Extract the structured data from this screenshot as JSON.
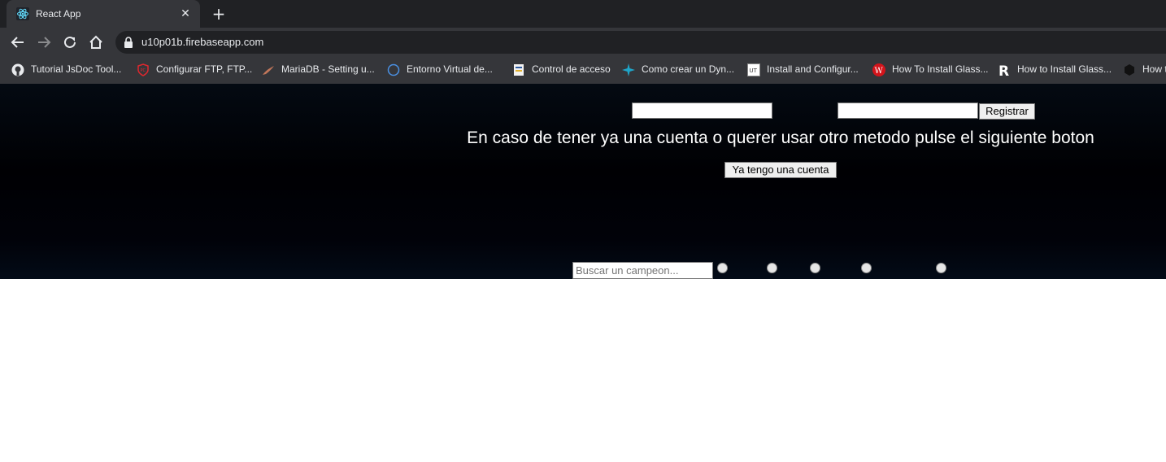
{
  "browser": {
    "tab": {
      "title": "React App",
      "favicon": "react-icon",
      "close_glyph": "✕"
    },
    "new_tab_glyph": "+",
    "toolbar": {
      "back_icon": "back-arrow-icon",
      "forward_icon": "forward-arrow-icon",
      "reload_icon": "reload-icon",
      "home_icon": "home-icon",
      "lock_icon": "lock-icon",
      "url": "u10p01b.firebaseapp.com"
    },
    "bookmarks": [
      {
        "label": "Tutorial JsDoc Tool...",
        "icon": "github-icon"
      },
      {
        "label": "Configurar FTP, FTP...",
        "icon": "shield-icon"
      },
      {
        "label": "MariaDB - Setting u...",
        "icon": "seal-icon"
      },
      {
        "label": "Entorno Virtual de...",
        "icon": "circle-icon"
      },
      {
        "label": "Control de acceso",
        "icon": "document-icon"
      },
      {
        "label": "Como crear un Dyn...",
        "icon": "star-icon"
      },
      {
        "label": "Install and Configur...",
        "icon": "ut-icon"
      },
      {
        "label": "How To Install Glass...",
        "icon": "w-icon"
      },
      {
        "label": "How to Install Glass...",
        "icon": "r-icon"
      },
      {
        "label": "How t",
        "icon": "hex-icon"
      }
    ]
  },
  "page": {
    "register": {
      "button_label": "Registrar"
    },
    "headline": "En caso de tener ya una cuenta o querer usar otro metodo pulse el siguiente boton",
    "have_account_button": "Ya tengo una cuenta",
    "search": {
      "placeholder": "Buscar un campeon..."
    }
  },
  "colors": {
    "page_background": "#000003",
    "headline_text": "#ffffff",
    "chrome_dark": "#202124",
    "chrome_toolbar": "#35363a"
  }
}
